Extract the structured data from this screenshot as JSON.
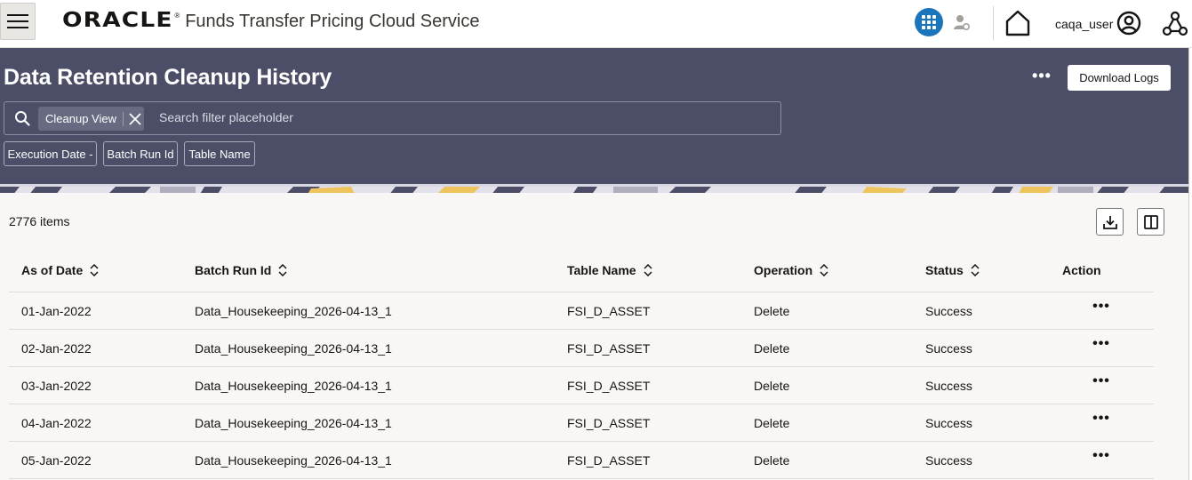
{
  "topbar": {
    "brand_logo": "ORACLE",
    "brand_reg": "®",
    "product_name": "Funds Transfer Pricing Cloud Service",
    "username": "caqa_user",
    "accent_color": "#1b75bb"
  },
  "header": {
    "title": "Data Retention Cleanup History",
    "more_label": "•••",
    "download_logs_label": "Download Logs",
    "search": {
      "chip_label": "Cleanup View",
      "placeholder": "Search filter placeholder"
    },
    "filters": [
      "Execution Date -",
      "Batch Run Id",
      "Table Name"
    ]
  },
  "content": {
    "item_count": "2776 items",
    "columns": [
      "As of Date",
      "Batch Run Id",
      "Table Name",
      "Operation",
      "Status",
      "Action"
    ],
    "rows": [
      {
        "as_of_date": "01-Jan-2022",
        "batch_run_id": "Data_Housekeeping_2026-04-13_1",
        "table_name": "FSI_D_ASSET",
        "operation": "Delete",
        "status": "Success",
        "action": "•••"
      },
      {
        "as_of_date": "02-Jan-2022",
        "batch_run_id": "Data_Housekeeping_2026-04-13_1",
        "table_name": "FSI_D_ASSET",
        "operation": "Delete",
        "status": "Success",
        "action": "•••"
      },
      {
        "as_of_date": "03-Jan-2022",
        "batch_run_id": "Data_Housekeeping_2026-04-13_1",
        "table_name": "FSI_D_ASSET",
        "operation": "Delete",
        "status": "Success",
        "action": "•••"
      },
      {
        "as_of_date": "04-Jan-2022",
        "batch_run_id": "Data_Housekeeping_2026-04-13_1",
        "table_name": "FSI_D_ASSET",
        "operation": "Delete",
        "status": "Success",
        "action": "•••"
      },
      {
        "as_of_date": "05-Jan-2022",
        "batch_run_id": "Data_Housekeeping_2026-04-13_1",
        "table_name": "FSI_D_ASSET",
        "operation": "Delete",
        "status": "Success",
        "action": "•••"
      }
    ]
  }
}
